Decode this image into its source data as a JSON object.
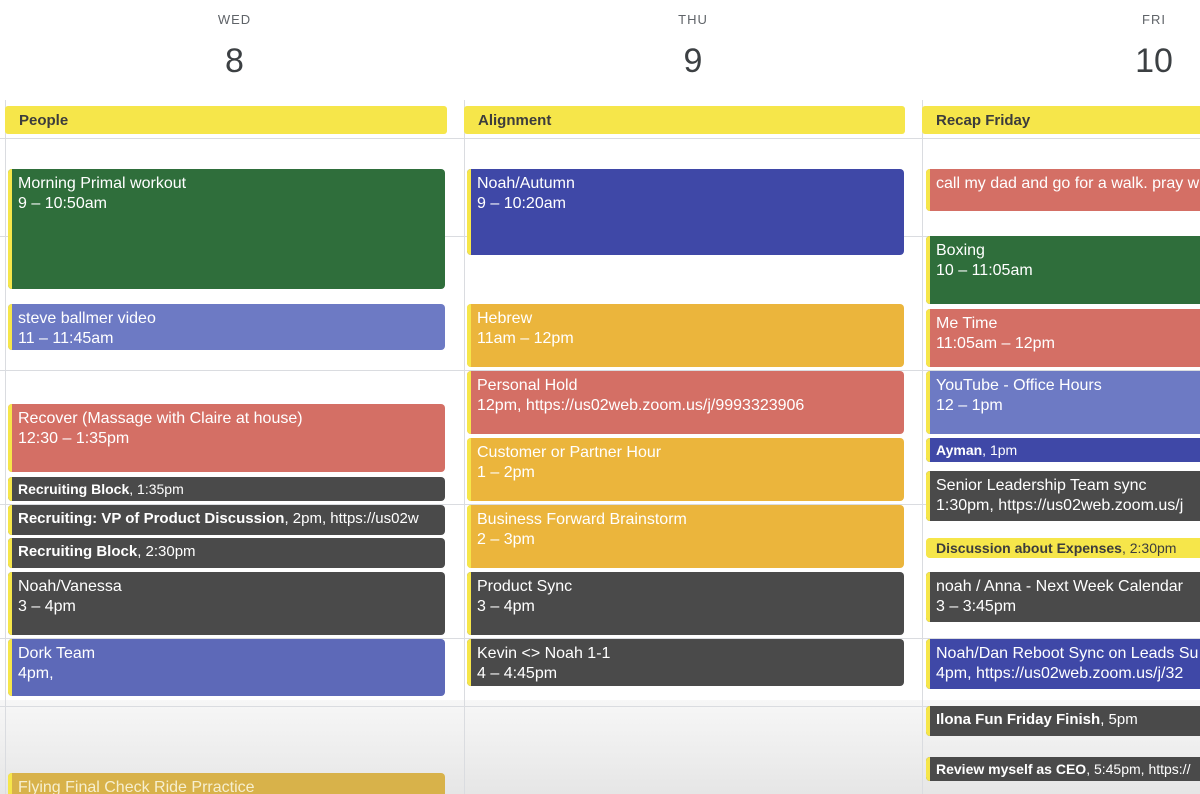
{
  "days": [
    {
      "dow": "WED",
      "num": "8",
      "allday": "People"
    },
    {
      "dow": "THU",
      "num": "9",
      "allday": "Alignment"
    },
    {
      "dow": "FRI",
      "num": "10",
      "allday": "Recap Friday"
    }
  ],
  "events": {
    "wed": [
      {
        "title": "Morning Primal workout",
        "sub": "9 – 10:50am"
      },
      {
        "title": "steve ballmer video",
        "sub": "11 – 11:45am"
      },
      {
        "title": "Recover (Massage with Claire at house)",
        "sub": "12:30 – 1:35pm"
      },
      {
        "title": "Recruiting Block",
        "sub": ", 1:35pm"
      },
      {
        "title": "Recruiting: VP of Product Discussion",
        "sub": ", 2pm, https://us02w"
      },
      {
        "title": "Recruiting Block",
        "sub": ", 2:30pm"
      },
      {
        "title": "Noah/Vanessa",
        "sub": "3 – 4pm"
      },
      {
        "title": "Dork Team",
        "sub": "4pm,"
      },
      {
        "title": "Flying Final Check Ride Prractice",
        "sub": ""
      }
    ],
    "thu": [
      {
        "title": "Noah/Autumn",
        "sub": "9 – 10:20am"
      },
      {
        "title": "Hebrew",
        "sub": "11am – 12pm"
      },
      {
        "title": "Personal Hold",
        "sub": "12pm, https://us02web.zoom.us/j/9993323906"
      },
      {
        "title": "Customer or Partner Hour",
        "sub": "1 – 2pm"
      },
      {
        "title": "Business Forward Brainstorm",
        "sub": "2 – 3pm"
      },
      {
        "title": "Product Sync",
        "sub": "3 – 4pm"
      },
      {
        "title": "Kevin <> Noah 1-1",
        "sub": "4 – 4:45pm"
      }
    ],
    "fri": [
      {
        "title": "call my dad and go for a walk. pray w",
        "sub": ""
      },
      {
        "title": "Boxing",
        "sub": "10 – 11:05am"
      },
      {
        "title": "Me Time",
        "sub": "11:05am – 12pm"
      },
      {
        "title": "YouTube - Office Hours",
        "sub": "12 – 1pm"
      },
      {
        "title": "Ayman",
        "sub": ", 1pm"
      },
      {
        "title": "Senior Leadership Team sync",
        "sub": "1:30pm, https://us02web.zoom.us/j"
      },
      {
        "title": "Discussion about Expenses",
        "sub": ", 2:30pm"
      },
      {
        "title": "noah / Anna - Next Week Calendar",
        "sub": "3 – 3:45pm"
      },
      {
        "title": "Noah/Dan Reboot Sync on Leads Su",
        "sub": "4pm, https://us02web.zoom.us/j/32"
      },
      {
        "title": "Ilona Fun Friday Finish",
        "sub": ", 5pm"
      },
      {
        "title": "Review myself as CEO",
        "sub": ", 5:45pm, https://"
      }
    ]
  },
  "colors": {
    "green": "#2f6e3b",
    "blue": "#3f48a7",
    "lavender": "#6d7ac4",
    "red": "#d46f65",
    "yellow": "#ebb53c",
    "dark": "#4a4a4a",
    "allday_yellow": "#f6e64a"
  }
}
